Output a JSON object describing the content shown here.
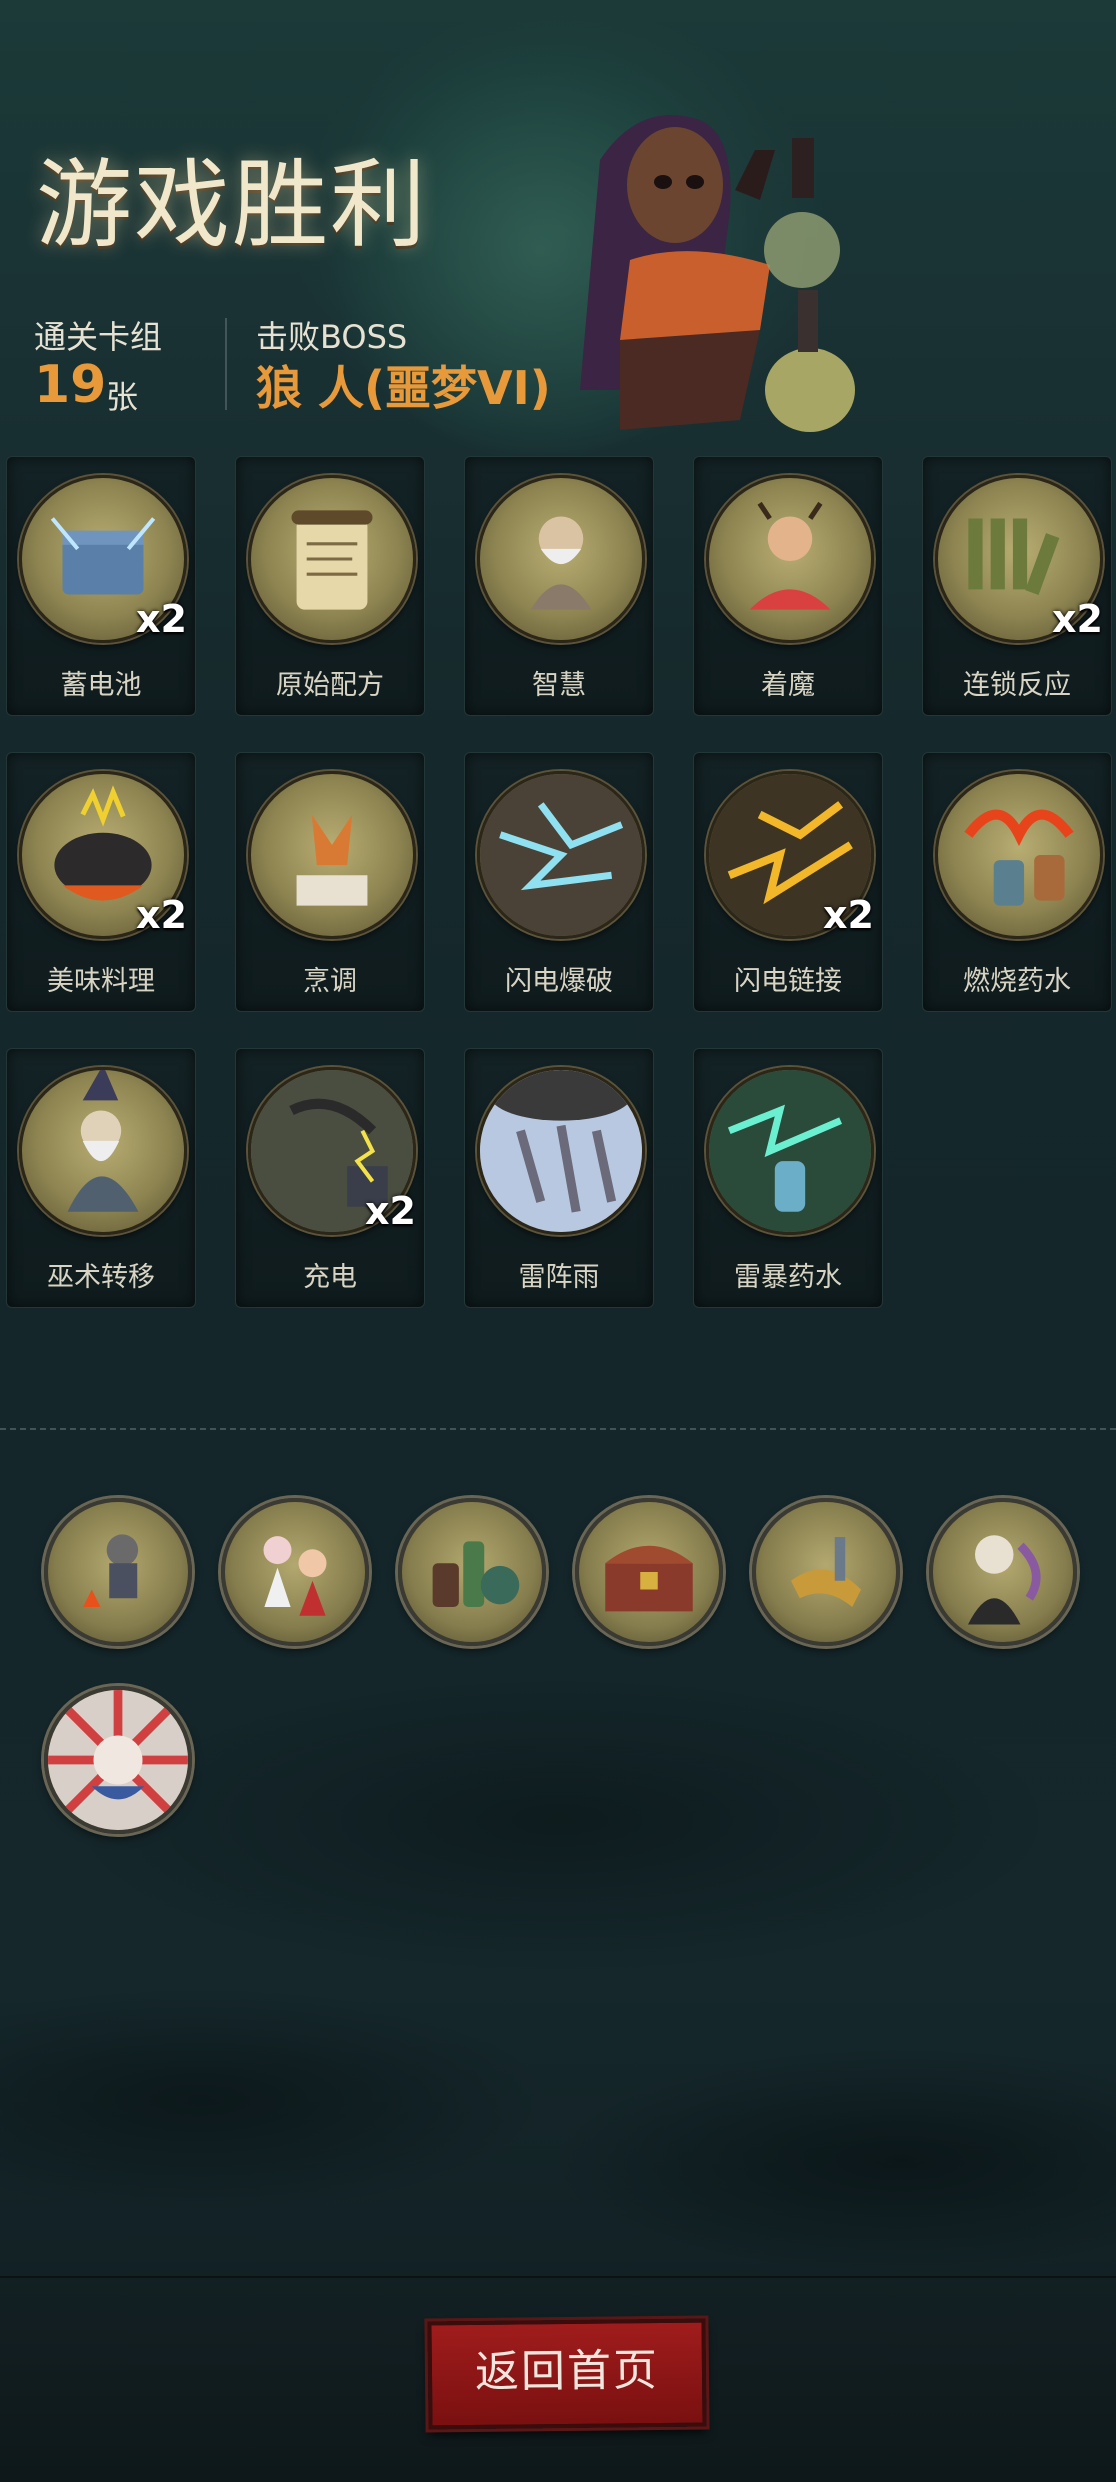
{
  "header": {
    "title": "游戏胜利",
    "cleared_deck_label": "通关卡组",
    "cleared_deck_count": "19",
    "cleared_deck_unit": "张",
    "boss_label": "击败BOSS",
    "boss_name": "狼 人(噩梦VI)"
  },
  "cards": [
    {
      "name": "蓄电池",
      "count": "x2",
      "icon": "battery-chest-icon"
    },
    {
      "name": "原始配方",
      "count": "",
      "icon": "scroll-icon"
    },
    {
      "name": "智慧",
      "count": "",
      "icon": "sage-icon"
    },
    {
      "name": "着魔",
      "count": "",
      "icon": "possessed-icon"
    },
    {
      "name": "连锁反应",
      "count": "x2",
      "icon": "dominoes-icon"
    },
    {
      "name": "美味料理",
      "count": "x2",
      "icon": "cauldron-icon"
    },
    {
      "name": "烹调",
      "count": "",
      "icon": "fox-chef-icon"
    },
    {
      "name": "闪电爆破",
      "count": "",
      "icon": "lightning-blast-icon"
    },
    {
      "name": "闪电链接",
      "count": "x2",
      "icon": "lightning-chain-icon"
    },
    {
      "name": "燃烧药水",
      "count": "",
      "icon": "burning-potion-icon"
    },
    {
      "name": "巫术转移",
      "count": "",
      "icon": "wizard-icon"
    },
    {
      "name": "充电",
      "count": "x2",
      "icon": "charge-icon"
    },
    {
      "name": "雷阵雨",
      "count": "",
      "icon": "thunderstorm-icon"
    },
    {
      "name": "雷暴药水",
      "count": "",
      "icon": "storm-potion-icon"
    }
  ],
  "relics": [
    {
      "icon": "campfire-knight-icon"
    },
    {
      "icon": "dancing-girls-icon"
    },
    {
      "icon": "potion-bottles-icon"
    },
    {
      "icon": "treasure-chest-icon"
    },
    {
      "icon": "horn-icon"
    },
    {
      "icon": "vampire-icon"
    },
    {
      "icon": "jester-rabbit-icon"
    }
  ],
  "footer": {
    "home_button": "返回首页"
  },
  "colors": {
    "accent_orange": "#e89a3a",
    "button_red": "#a01c1c",
    "background": "#16262a"
  }
}
